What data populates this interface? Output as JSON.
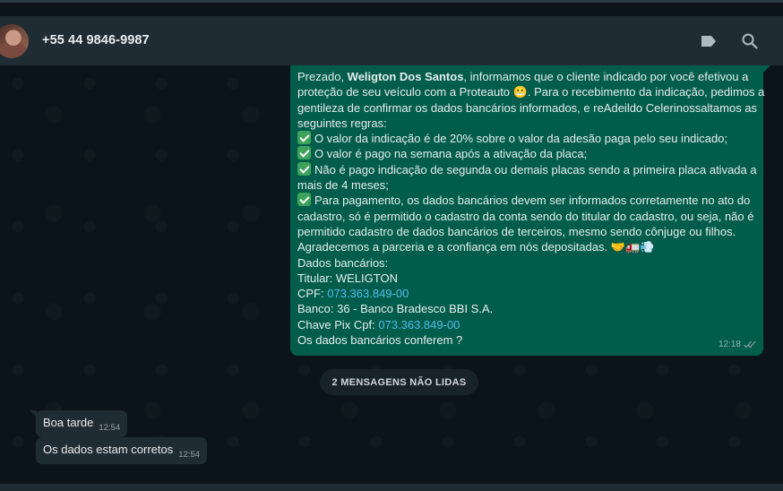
{
  "header": {
    "contact_name": "+55 44 9846-9987",
    "icons": [
      "label-icon",
      "search-icon"
    ]
  },
  "outgoing_message": {
    "greeting_prefix": "Prezado, ",
    "greeting_name": "Weligton Dos Santos",
    "l1_rest": ", informamos que o cliente indicado por você efetivou a",
    "l2": "proteção de seu veículo com a Proteauto",
    "l2b": ". Para o recebimento da indicação, pedimos a",
    "l3": "gentileza de confirmar os dados bancários informados, e reAdeildo Celerinossaltamos as",
    "l4": "seguintes regras:",
    "rule1": "O valor da indicação é de 20% sobre o valor da adesão paga pelo seu indicado;",
    "rule2": "O valor é pago na semana após a ativação da placa;",
    "rule3a": "Não é pago indicação de segunda ou demais placas sendo a primeira placa ativada a",
    "rule3b": "mais de 4 meses;",
    "rule4a": "Para pagamento, os dados bancários devem ser informados corretamente no ato do",
    "rule4b": "cadastro, só é permitido o cadastro da conta sendo do titular do cadastro, ou seja, não é",
    "rule4c": "permitido cadastro de dados bancários de terceiros, mesmo sendo cônjuge ou filhos.",
    "thanks": "Agradecemos a parceria e a confiança em nós depositadas.",
    "bank_title": "Dados bancários:",
    "holder": "Titular: WELIGTON",
    "cpf_label": "CPF: ",
    "cpf_value": "073.363.849-00",
    "bank": "Banco: 36 - Banco Bradesco BBI S.A.",
    "pix_label": "Chave Pix Cpf: ",
    "pix_value": "073.363.849-00",
    "question": "Os dados bancários conferem ?",
    "time": "12:18"
  },
  "unread_divider": "2 MENSAGENS NÃO LIDAS",
  "incoming_messages": [
    {
      "text": "Boa tarde",
      "time": "12:54"
    },
    {
      "text": "Os dados estam corretos",
      "time": "12:54"
    }
  ],
  "colors": {
    "outgoing_bubble": "#005c4b",
    "incoming_bubble": "#202c33",
    "background": "#0b141a",
    "link": "#53bdeb"
  }
}
